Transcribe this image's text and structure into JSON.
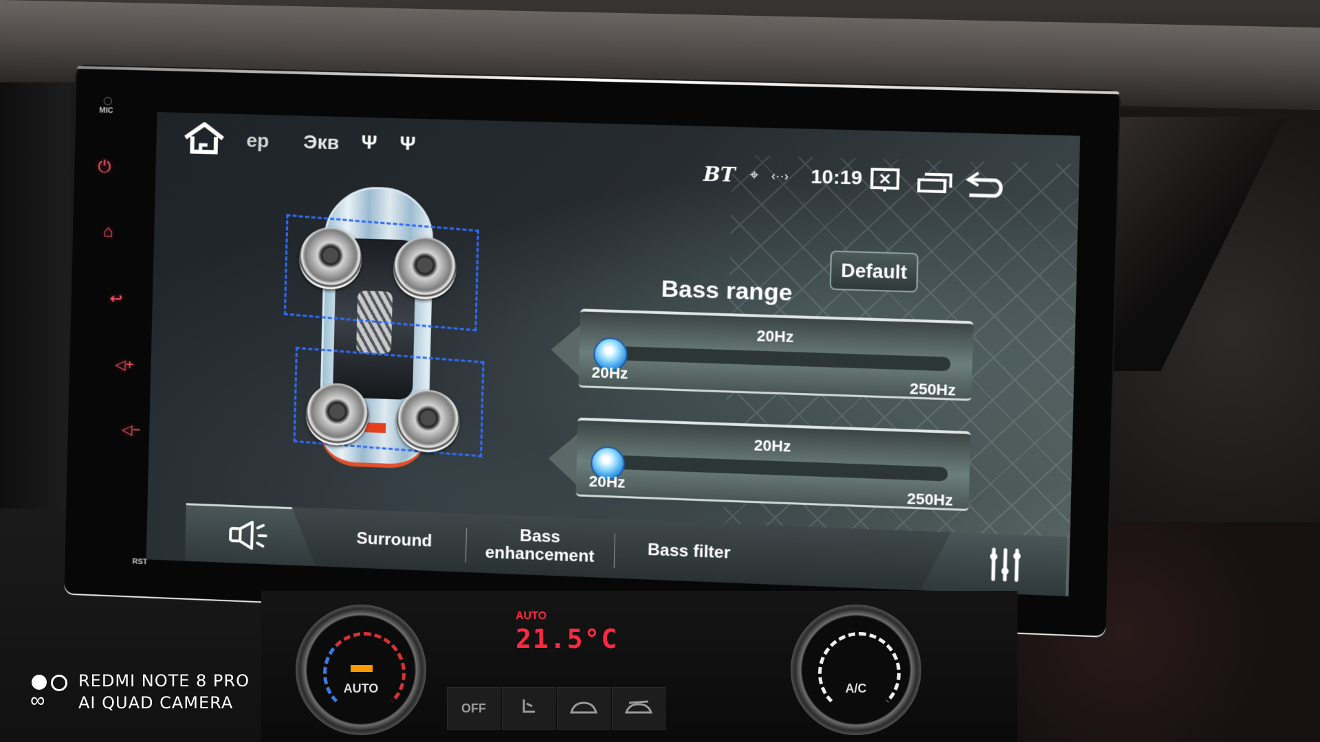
{
  "hardware": {
    "mic_label": "MIC",
    "rst_label": "RST",
    "buttons": [
      {
        "name": "power",
        "glyph": "⏻"
      },
      {
        "name": "home",
        "glyph": "⌂"
      },
      {
        "name": "back",
        "glyph": "↩"
      },
      {
        "name": "volume-up",
        "glyph": "◁+"
      },
      {
        "name": "volume-down",
        "glyph": "◁−"
      }
    ]
  },
  "statusbar": {
    "tabs": [
      "ер",
      "Экв"
    ],
    "usb_glyph": "Ψ",
    "bt_label": "BT",
    "location_glyph": "⌖",
    "swap_glyph": "‹··›",
    "time": "10:19"
  },
  "panel": {
    "default_label": "Default",
    "title": "Bass range",
    "sliders": [
      {
        "current": "20Hz",
        "min": "20Hz",
        "max": "250Hz",
        "value_fraction": 0.0
      },
      {
        "current": "20Hz",
        "min": "20Hz",
        "max": "250Hz",
        "value_fraction": 0.0
      }
    ]
  },
  "speaker_zones": [
    "front",
    "rear"
  ],
  "tabbar": {
    "tabs": [
      {
        "label": "Surround"
      },
      {
        "label": "Bass enhancement"
      },
      {
        "label": "Bass filter"
      }
    ]
  },
  "climate": {
    "left_knob_label": "AUTO",
    "right_knob_label": "A/C",
    "display_mode": "AUTO",
    "display_temp": "21.5°C",
    "buttons": [
      "OFF",
      "",
      "",
      ""
    ]
  },
  "watermark": {
    "line1": "REDMI NOTE 8 PRO",
    "line2": "AI QUAD CAMERA"
  },
  "colors": {
    "hw_button": "#ff5a6e",
    "zone_border": "#2f6bff",
    "slider_knob": "#2f95e0",
    "climate_display": "#ff2840"
  }
}
